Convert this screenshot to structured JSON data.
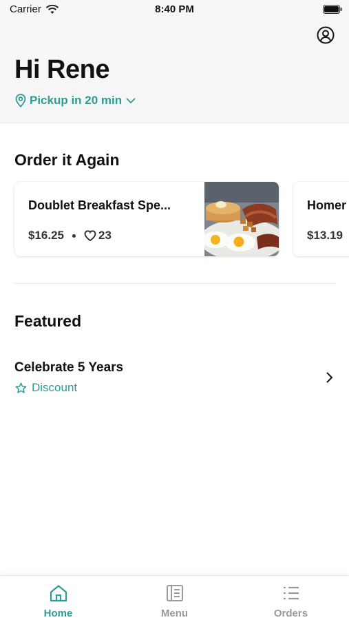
{
  "status_bar": {
    "carrier": "Carrier",
    "time": "8:40 PM"
  },
  "header": {
    "greeting": "Hi Rene",
    "pickup_label": "Pickup in 20 min"
  },
  "order_again": {
    "title": "Order it Again",
    "items": [
      {
        "name": "Doublet Breakfast Spe...",
        "price": "$16.25",
        "likes": "23"
      },
      {
        "name": "Homer",
        "price": "$13.19"
      }
    ]
  },
  "featured": {
    "title": "Featured",
    "items": [
      {
        "name": "Celebrate 5 Years",
        "tag": "Discount"
      }
    ]
  },
  "tab_bar": {
    "tabs": [
      {
        "label": "Home",
        "active": true
      },
      {
        "label": "Menu",
        "active": false
      },
      {
        "label": "Orders",
        "active": false
      }
    ]
  },
  "colors": {
    "accent": "#2a9d95",
    "header_bg": "#f6f6f6",
    "inactive": "#9a9a9a"
  },
  "icons": {
    "profile": "user-circle-icon",
    "pickup": "location-pin-icon",
    "dropdown": "chevron-down-icon",
    "like": "heart-icon",
    "featured_tag": "star-icon",
    "featured_nav": "chevron-right-icon",
    "home": "home-icon",
    "menu": "menu-book-icon",
    "orders": "list-icon"
  }
}
